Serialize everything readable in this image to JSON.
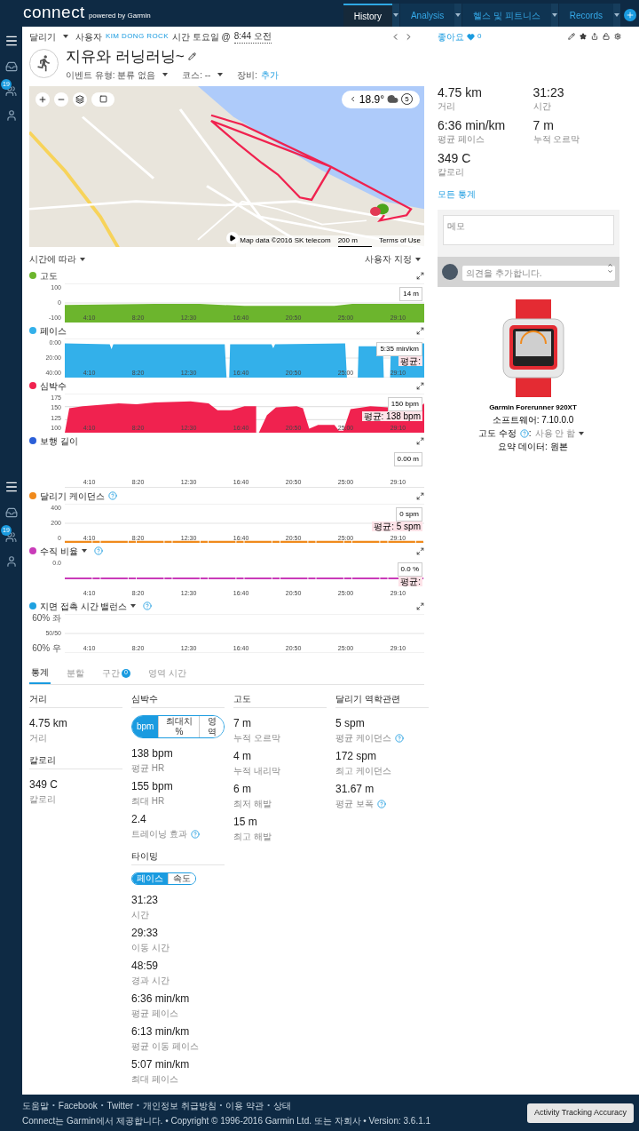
{
  "header": {
    "logo": "connect",
    "tagline": "powered by Garmin",
    "nav": [
      {
        "label": "History",
        "selected": true
      },
      {
        "label": "Analysis",
        "selected": false
      },
      {
        "label": "헬스 및 피트니스",
        "selected": false
      },
      {
        "label": "Records",
        "selected": false
      }
    ]
  },
  "sidebar": {
    "badges": [
      "19",
      "19"
    ]
  },
  "activity": {
    "type": "달리기",
    "by": "사용자",
    "user": "KIM DONG ROCK",
    "when": "시간 토요일 @",
    "time": "8:44 오전",
    "title": "지유와 러닝러닝~",
    "event_type": "이벤트 유형: 분류 없음",
    "course": "코스: --",
    "gear_label": "장비:",
    "gear_link": "추가"
  },
  "social": {
    "like": "좋아요",
    "count": "0"
  },
  "map": {
    "temperature": "18.9°",
    "laps": "5",
    "attribution": "Map data ©2016 SK telecom",
    "scale": "200 m",
    "terms": "Terms of Use"
  },
  "chart_toolbar": {
    "left": "시간에 따라",
    "right": "사용자 지정"
  },
  "charts": [
    {
      "title": "고도",
      "color": "#6cb52d",
      "kind": "area",
      "help": false,
      "dropdown": false,
      "y_ticks": [
        "100",
        "0",
        "-100"
      ],
      "x_ticks": [
        "4:10",
        "8:20",
        "12:30",
        "16:40",
        "20:50",
        "25:00",
        "29:10"
      ],
      "value": "14 m"
    },
    {
      "title": "페이스",
      "color": "#33b0ea",
      "kind": "area",
      "help": false,
      "dropdown": false,
      "y_ticks": [
        "0:00",
        "20:00",
        "40:00"
      ],
      "x_ticks": [
        "4:10",
        "8:20",
        "12:30",
        "16:40",
        "20:50",
        "25:00",
        "29:10"
      ],
      "value": "5:35 min/km",
      "average": "평균:"
    },
    {
      "title": "심박수",
      "color": "#f0224f",
      "kind": "area",
      "help": false,
      "dropdown": false,
      "y_ticks": [
        "175",
        "150",
        "125",
        "100"
      ],
      "x_ticks": [
        "4:10",
        "8:20",
        "12:30",
        "16:40",
        "20:50",
        "25:00",
        "29:10"
      ],
      "value": "150 bpm",
      "average": "평균: 138 bpm"
    },
    {
      "title": "보행 길이",
      "color": "#2b5fd8",
      "kind": "empty",
      "help": false,
      "dropdown": false,
      "x_ticks": [
        "4:10",
        "8:20",
        "12:30",
        "16:40",
        "20:50",
        "25:00",
        "29:10"
      ],
      "value": "0.00 m"
    },
    {
      "title": "달리기 케이던스",
      "color": "#f08a1c",
      "kind": "line",
      "help": true,
      "dropdown": false,
      "y_ticks": [
        "400",
        "200",
        "0"
      ],
      "x_ticks": [
        "4:10",
        "8:20",
        "12:30",
        "16:40",
        "20:50",
        "25:00",
        "29:10"
      ],
      "value": "0 spm",
      "average": "평균: 5 spm"
    },
    {
      "title": "수직 비율",
      "color": "#c93bb9",
      "kind": "line",
      "help": true,
      "dropdown": true,
      "y_ticks": [
        "0.0"
      ],
      "x_ticks": [
        "4:10",
        "8:20",
        "12:30",
        "16:40",
        "20:50",
        "25:00",
        "29:10"
      ],
      "value": "0.0 %",
      "average": "평균:"
    },
    {
      "title": "지면 접촉 시간 밸런스",
      "color": "#1ea1e0",
      "kind": "empty",
      "help": true,
      "dropdown": true,
      "y_ticks": [
        "60% 좌",
        "50/50",
        "60% 우"
      ],
      "x_ticks": [
        "4:10",
        "8:20",
        "12:30",
        "16:40",
        "20:50",
        "25:00",
        "29:10"
      ]
    }
  ],
  "stat_tabs": [
    {
      "label": "통계",
      "selected": true
    },
    {
      "label": "분할",
      "selected": false
    },
    {
      "label": "구간",
      "selected": false,
      "badge": "0"
    },
    {
      "label": "영역 시간",
      "selected": false
    }
  ],
  "stat_columns": [
    [
      {
        "title": "거리",
        "items": [
          {
            "value": "4.75 km",
            "label": "거리",
            "help": false
          }
        ]
      },
      {
        "title": "칼로리",
        "items": [
          {
            "value": "349 C",
            "label": "칼로리",
            "help": false
          }
        ]
      }
    ],
    [
      {
        "title": "심박수",
        "toggle": [
          {
            "label": "bpm",
            "selected": true
          },
          {
            "label": "최대치 %",
            "selected": false
          },
          {
            "label": "영역",
            "selected": false
          }
        ],
        "items": [
          {
            "value": "138 bpm",
            "label": "평균 HR",
            "help": false
          },
          {
            "value": "155 bpm",
            "label": "최대 HR",
            "help": false
          },
          {
            "value": "2.4",
            "label": "트레이닝 효과",
            "help": true
          }
        ]
      },
      {
        "title": "타이밍",
        "toggle": [
          {
            "label": "페이스",
            "selected": true
          },
          {
            "label": "속도",
            "selected": false
          }
        ],
        "items": [
          {
            "value": "31:23",
            "label": "시간",
            "help": false
          },
          {
            "value": "29:33",
            "label": "이동 시간",
            "help": false
          },
          {
            "value": "48:59",
            "label": "경과 시간",
            "help": false
          },
          {
            "value": "6:36 min/km",
            "label": "평균 페이스",
            "help": false
          },
          {
            "value": "6:13 min/km",
            "label": "평균 이동 페이스",
            "help": false
          },
          {
            "value": "5:07 min/km",
            "label": "최대 페이스",
            "help": false
          }
        ]
      }
    ],
    [
      {
        "title": "고도",
        "items": [
          {
            "value": "7 m",
            "label": "누적 오르막",
            "help": false
          },
          {
            "value": "4 m",
            "label": "누적 내리막",
            "help": false
          },
          {
            "value": "6 m",
            "label": "최저 해발",
            "help": false
          },
          {
            "value": "15 m",
            "label": "최고 해발",
            "help": false
          }
        ]
      }
    ],
    [
      {
        "title": "달리기 역학관련",
        "items": [
          {
            "value": "5 spm",
            "label": "평균 케이던스",
            "help": true
          },
          {
            "value": "172 spm",
            "label": "최고 케이던스",
            "help": false
          },
          {
            "value": "31.67 m",
            "label": "평균 보폭",
            "help": true
          }
        ]
      }
    ]
  ],
  "summary": [
    {
      "value": "4.75 km",
      "label": "거리"
    },
    {
      "value": "31:23",
      "label": "시간"
    },
    {
      "value": "6:36 min/km",
      "label": "평균 페이스"
    },
    {
      "value": "7 m",
      "label": "누적 오르막"
    },
    {
      "value": "349 C",
      "label": "칼로리"
    }
  ],
  "all_stats_link": "모든 통계",
  "notes": {
    "placeholder": "메모"
  },
  "comment": {
    "placeholder": "의견을 추가합니다."
  },
  "device": {
    "name": "Garmin Forerunner 920XT",
    "software": "소프트웨어: 7.10.0.0",
    "correction_label": "고도 수정",
    "correction_sep": ":",
    "correction_value": "사용 안 함",
    "summary_data": "요약 데이터: 원본"
  },
  "footer": {
    "links": [
      "도움말",
      "Facebook",
      "Twitter",
      "개인정보 취급방침",
      "이용 약관",
      "상태"
    ],
    "separator": "•",
    "copyright": "Connect는 Garmin에서 제공합니다. • Copyright © 1996-2016 Garmin Ltd. 또는 자회사 • Version: 3.6.1.1",
    "button": "Activity Tracking Accuracy"
  }
}
